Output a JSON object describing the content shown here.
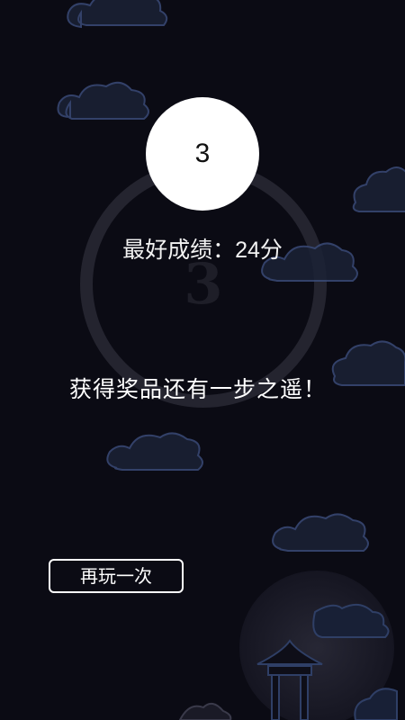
{
  "game": {
    "score": "3",
    "watermark_digit": "3",
    "best_score_label": "最好成绩：",
    "best_score_value": "24",
    "best_score_unit": "分",
    "message": "获得奖品还有一步之遥！",
    "replay_label": "再玩一次"
  },
  "colors": {
    "background": "#0b0b14",
    "cloud": "#1e2a44",
    "text": "#ffffff"
  }
}
